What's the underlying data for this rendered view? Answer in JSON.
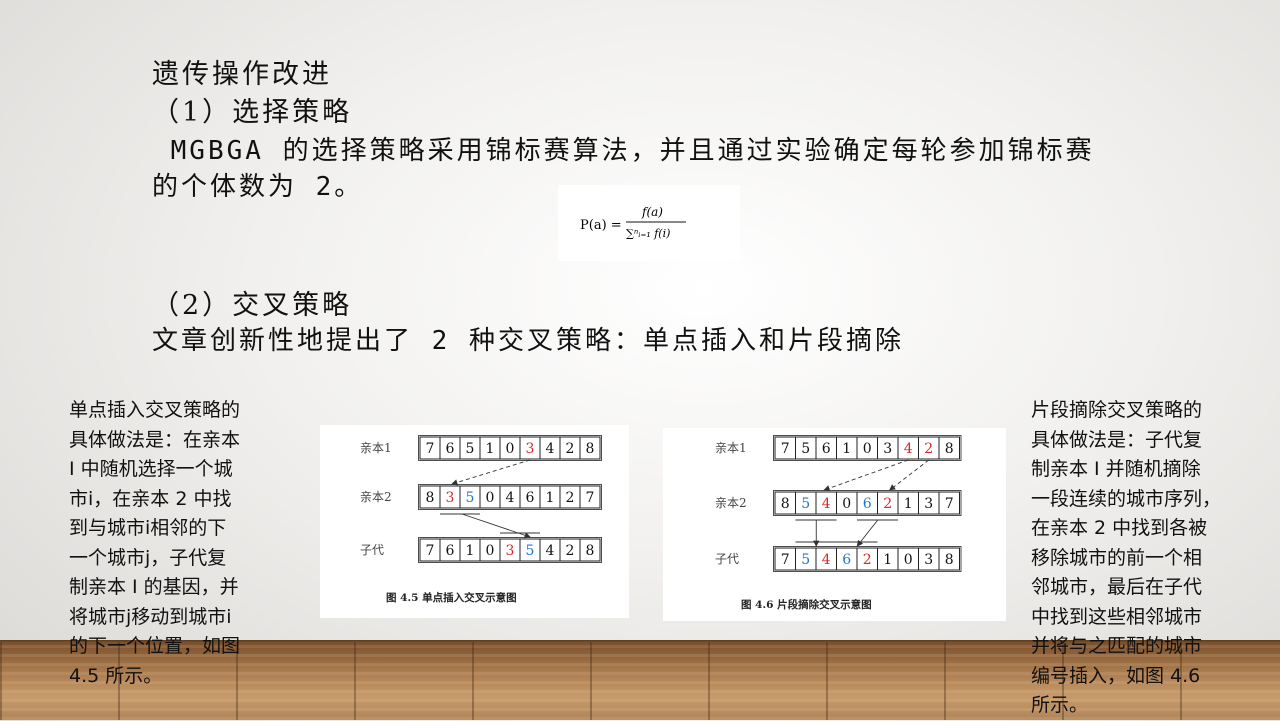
{
  "slide": {
    "title": "遗传操作改进",
    "section1_heading": "（1）选择策略",
    "section1_line1": " MGBGA 的选择策略采用锦标赛算法，并且通过实验确定每轮参加锦标赛",
    "section1_line2": "的个体数为 2。",
    "section2_heading": "（2）交叉策略",
    "section2_line": "文章创新性地提出了 2 种交叉策略：单点插入和片段摘除"
  },
  "formula": {
    "lhs": "P(a) =",
    "numerator": "f(a)",
    "denominator": "∑ⁿᵢ₌₁ f(i)"
  },
  "left_note": "单点插入交叉策略的\n具体做法是：在亲本\nⅠ 中随机选择一个城\n市i，在亲本 2 中找\n到与城市i相邻的下\n一个城市j，子代复\n制亲本 Ⅰ 的基因，并\n将城市j移动到城市i\n的下一个位置，如图\n4.5 所示。",
  "right_note": "片段摘除交叉策略的\n具体做法是：子代复\n制亲本 Ⅰ 并随机摘除\n一段连续的城市序列，\n在亲本 2 中找到各被\n移除城市的前一个相\n邻城市，最后在子代\n中找到这些相邻城市\n并将与之匹配的城市\n编号插入，如图 4.6\n所示。",
  "colors": {
    "red": "#d62828",
    "blue": "#1f77c9"
  },
  "fig45": {
    "caption": "图 4.5  单点插入交叉示意图",
    "rows": [
      {
        "label": "亲本1",
        "genes": [
          "7",
          "6",
          "5",
          "1",
          "0",
          "3",
          "4",
          "2",
          "8"
        ],
        "red": [
          5
        ],
        "blue": []
      },
      {
        "label": "亲本2",
        "genes": [
          "8",
          "3",
          "5",
          "0",
          "4",
          "6",
          "1",
          "2",
          "7"
        ],
        "red": [
          1
        ],
        "blue": [
          2
        ]
      },
      {
        "label": "子代",
        "genes": [
          "7",
          "6",
          "1",
          "0",
          "3",
          "5",
          "4",
          "2",
          "8"
        ],
        "red": [
          4
        ],
        "blue": [
          5
        ]
      }
    ]
  },
  "fig46": {
    "caption": "图 4.6  片段摘除交叉示意图",
    "rows": [
      {
        "label": "亲本1",
        "genes": [
          "7",
          "5",
          "6",
          "1",
          "0",
          "3",
          "4",
          "2",
          "8"
        ],
        "red": [
          6,
          7
        ],
        "blue": []
      },
      {
        "label": "亲本2",
        "genes": [
          "8",
          "5",
          "4",
          "0",
          "6",
          "2",
          "1",
          "3",
          "7"
        ],
        "red": [
          2,
          5
        ],
        "blue": [
          1,
          4
        ]
      },
      {
        "label": "子代",
        "genes": [
          "7",
          "5",
          "4",
          "6",
          "2",
          "1",
          "0",
          "3",
          "8"
        ],
        "red": [
          2,
          4
        ],
        "blue": [
          1,
          3
        ]
      }
    ]
  }
}
